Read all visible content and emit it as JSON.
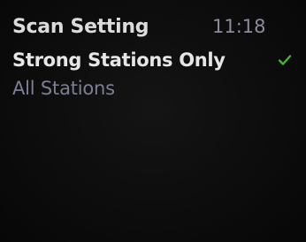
{
  "header": {
    "title": "Scan Setting",
    "time": "11:18"
  },
  "menu": {
    "items": [
      {
        "label": "Strong Stations Only",
        "selected": true,
        "icon": "check-icon"
      },
      {
        "label": "All Stations",
        "selected": false
      }
    ]
  },
  "colors": {
    "background": "#0b0b0b",
    "title": "#dcdcdc",
    "time": "#8a8c9c",
    "selected_text": "#e6e6e6",
    "unselected_text": "#7c7f94",
    "check": "#4fae3a"
  }
}
